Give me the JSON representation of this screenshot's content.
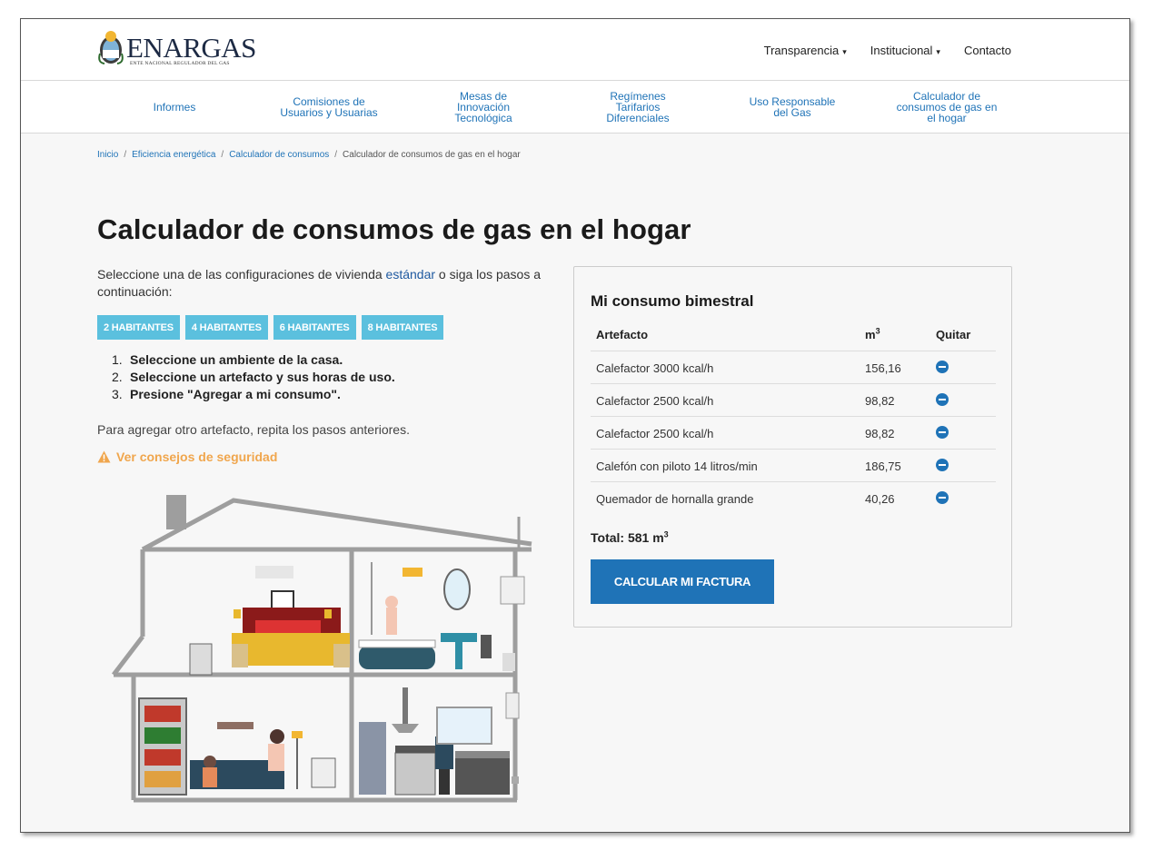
{
  "header": {
    "logo_text": "ENARGAS",
    "logo_subtitle": "ENTE NACIONAL REGULADOR DEL GAS",
    "top_links": [
      "Transparencia",
      "Institucional",
      "Contacto"
    ],
    "caret": "▾"
  },
  "main_nav": [
    "Informes",
    "Comisiones de\nUsuarios y Usuarias",
    "Mesas de\nInnovación\nTecnológica",
    "Regímenes\nTarifarios\nDiferenciales",
    "Uso Responsable\ndel Gas",
    "Calculador de\nconsumos de gas en\nel hogar"
  ],
  "breadcrumb": {
    "items": [
      "Inicio",
      "Eficiencia energética",
      "Calculador de consumos"
    ],
    "current": "Calculador de consumos de gas en el hogar",
    "separator": "/"
  },
  "page": {
    "title": "Calculador de consumos de gas en el hogar",
    "intro_before": "Seleccione una de las configuraciones de vivienda ",
    "intro_link": "estándar",
    "intro_after": " o siga los pasos a continuación:",
    "presets": [
      "2 HABITANTES",
      "4 HABITANTES",
      "6 HABITANTES",
      "8 HABITANTES"
    ],
    "steps": [
      {
        "num": "1.",
        "text": "Seleccione un ambiente de la casa."
      },
      {
        "num": "2.",
        "text": "Seleccione un artefacto y sus horas de uso."
      },
      {
        "num": "3.",
        "text": "Presione \"Agregar a mi consumo\"."
      }
    ],
    "repeat_note": "Para agregar otro artefacto, repita los pasos anteriores.",
    "safety_link": "Ver consejos de seguridad"
  },
  "consumption": {
    "title": "Mi consumo bimestral",
    "headers": {
      "artefacto": "Artefacto",
      "unit": "m",
      "unit_sup": "3",
      "quitar": "Quitar"
    },
    "rows": [
      {
        "name": "Calefactor 3000 kcal/h",
        "value": "156,16"
      },
      {
        "name": "Calefactor 2500 kcal/h",
        "value": "98,82"
      },
      {
        "name": "Calefactor 2500 kcal/h",
        "value": "98,82"
      },
      {
        "name": "Calefón con piloto 14 litros/min",
        "value": "186,75"
      },
      {
        "name": "Quemador de hornalla grande",
        "value": "40,26"
      }
    ],
    "total_label": "Total: 581 m",
    "total_sup": "3",
    "button": "CALCULAR MI FACTURA"
  },
  "colors": {
    "link_blue": "#1f73b7",
    "preset_cyan": "#5bc0de",
    "warning_orange": "#f0a64d",
    "page_bg": "#f7f7f7"
  }
}
